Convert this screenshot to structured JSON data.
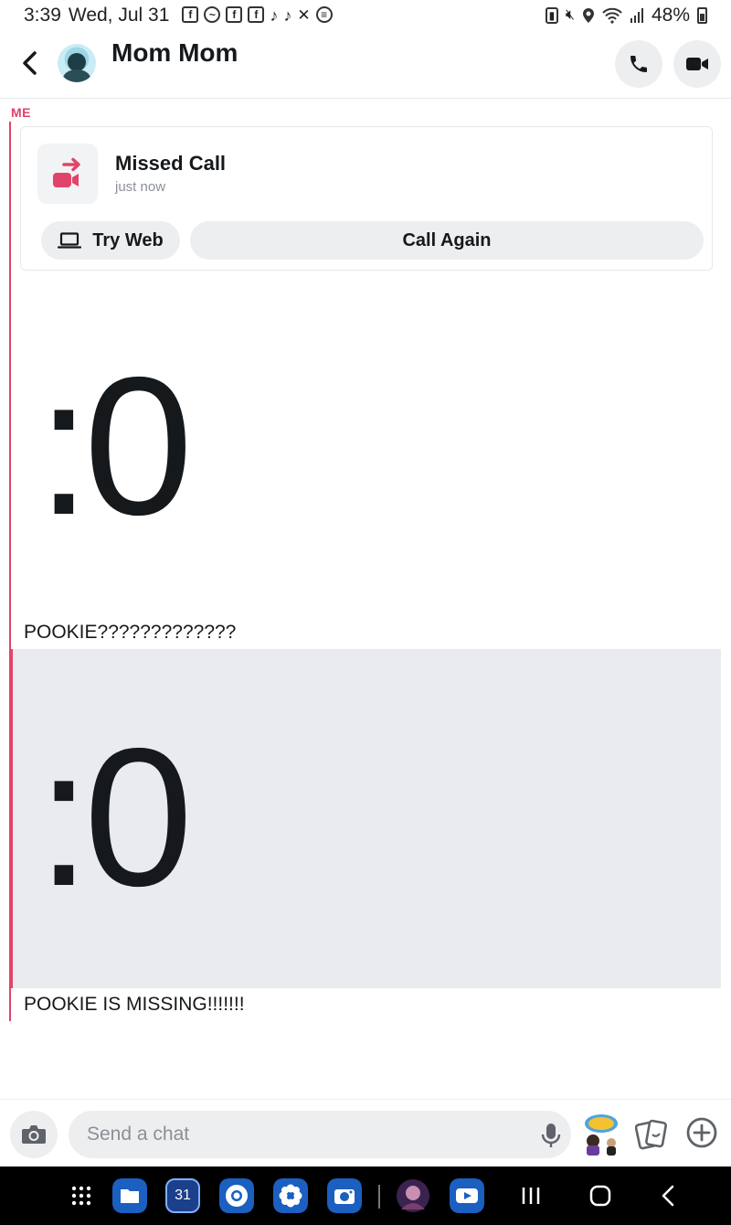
{
  "status_bar": {
    "time": "3:39",
    "date": "Wed, Jul 31",
    "battery": "48%",
    "left_icons": [
      "facebook-icon",
      "messenger-icon",
      "facebook-icon",
      "facebook-icon",
      "tiktok-icon",
      "tiktok-icon",
      "capcut-icon",
      "spotify-icon"
    ],
    "right_icons": [
      "battery-saver-icon",
      "mute-icon",
      "location-icon",
      "wifi-icon",
      "signal-icon"
    ]
  },
  "header": {
    "contact_name": "Mom Mom"
  },
  "messages": {
    "sender_label": "ME",
    "missed_call": {
      "title": "Missed Call",
      "time": "just now",
      "try_web_label": "Try Web",
      "call_again_label": "Call Again"
    },
    "emoji_1": ":0",
    "text_1": "POOKIE?????????????",
    "emoji_2": ":0",
    "text_2": "POOKIE IS MISSING!!!!!!!"
  },
  "chat_bar": {
    "placeholder": "Send a chat"
  },
  "nav_bar": {
    "apps": [
      "app-drawer-icon",
      "files-icon",
      "calendar-icon",
      "chrome-icon",
      "flower-app-icon",
      "camera-app-icon",
      "game-app-icon",
      "youtube-icon"
    ],
    "calendar_day": "31"
  },
  "colors": {
    "accent_red": "#e1446a",
    "text_dark": "#16191c",
    "muted": "#8b9097",
    "button_bg": "#edeef0",
    "highlight_bg": "#e9ebee"
  }
}
